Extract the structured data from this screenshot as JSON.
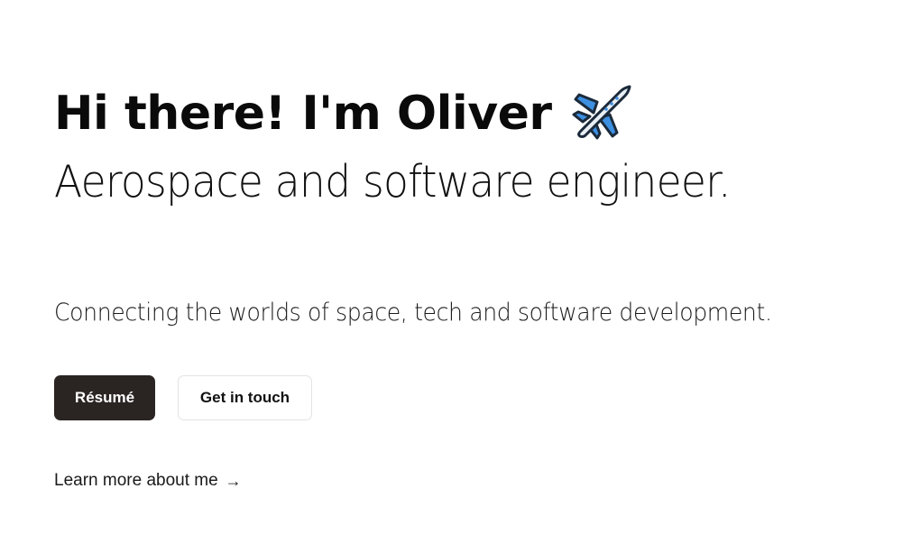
{
  "hero": {
    "headline": "Hi there! I'm Oliver",
    "headline_icon": "airplane-icon",
    "subheadline": "Aerospace and software engineer.",
    "tagline": "Connecting the worlds of space, tech and software development."
  },
  "actions": {
    "resume_label": "Résumé",
    "contact_label": "Get in touch"
  },
  "link": {
    "learn_more_label": "Learn more about me",
    "arrow": "→"
  },
  "colors": {
    "primary_button_bg": "#2a2523",
    "secondary_button_border": "#e3e3e3",
    "plane_blue": "#3d8fe0"
  }
}
